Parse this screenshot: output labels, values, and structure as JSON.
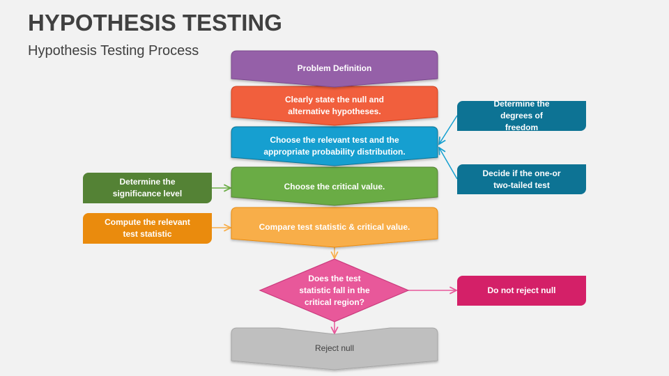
{
  "header": {
    "title": "HYPOTHESIS TESTING",
    "subtitle": "Hypothesis Testing Process"
  },
  "colors": {
    "background": "#f2f2f2",
    "step_problem": "#9560a8",
    "step_state": "#f15e3c",
    "step_choose_test": "#139fd0",
    "step_critical": "#6aac44",
    "step_compare": "#f8ae4a",
    "decision": "#e8589a",
    "reject": "#bfbfbf",
    "side_teal": "#0d7394",
    "side_green": "#548235",
    "side_orange": "#ea8b0d",
    "side_magenta": "#d42068"
  },
  "flow": {
    "steps": [
      {
        "id": "problem",
        "label": "Problem Definition"
      },
      {
        "id": "state",
        "label": "Clearly state the null and alternative hypotheses."
      },
      {
        "id": "choose_test",
        "label": "Choose the relevant test and the appropriate probability distribution."
      },
      {
        "id": "critical",
        "label": "Choose the critical value."
      },
      {
        "id": "compare",
        "label": "Compare test statistic & critical value."
      }
    ],
    "decision": {
      "label": "Does the test statistic fall in the critical region?"
    },
    "reject": {
      "label": "Reject null"
    },
    "not_reject": {
      "label": "Do not reject null"
    }
  },
  "side_notes": {
    "degrees_of_freedom": "Determine the degrees of freedom",
    "one_or_two_tailed": "Decide if the one-or two-tailed test",
    "significance_level": "Determine the significance level",
    "test_statistic": "Compute the relevant test statistic"
  }
}
